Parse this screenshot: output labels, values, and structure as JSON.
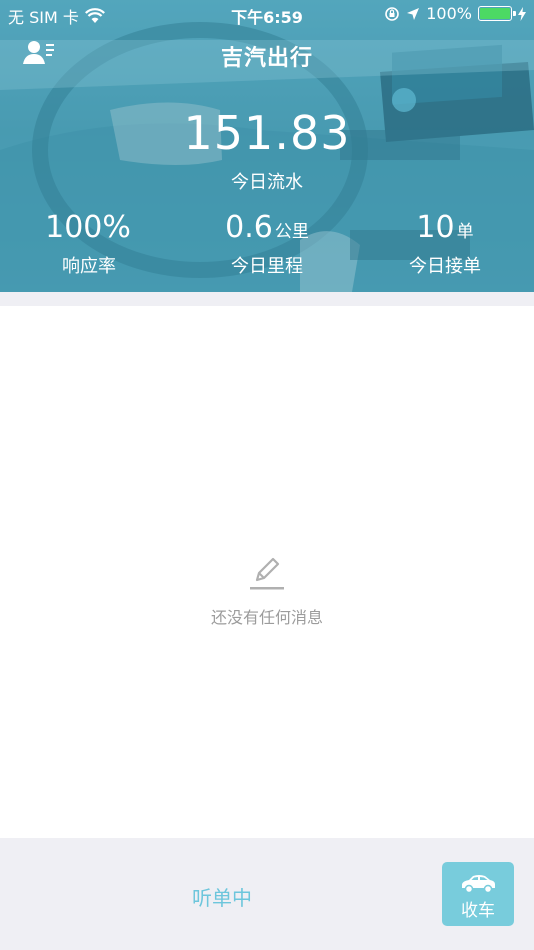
{
  "status_bar": {
    "carrier": "无 SIM 卡",
    "time": "下午6:59",
    "battery": "100%",
    "battery_level": 1.0
  },
  "header": {
    "title": "吉汽出行"
  },
  "revenue": {
    "value": "151.83",
    "label": "今日流水"
  },
  "stats": [
    {
      "value": "100%",
      "unit": "",
      "label": "响应率"
    },
    {
      "value": "0.6",
      "unit": "公里",
      "label": "今日里程"
    },
    {
      "value": "10",
      "unit": "单",
      "label": "今日接单"
    }
  ],
  "empty_state": {
    "icon": "pencil-icon",
    "text": "还没有任何消息"
  },
  "bottom_bar": {
    "status": "听单中",
    "collect_label": "收车",
    "collect_icon": "car-icon"
  },
  "colors": {
    "accent": "#6dc6dc",
    "button": "#78ccdc",
    "hero": "#4e98ad",
    "battery_green": "#4cd964",
    "muted_text": "#9c9c9c",
    "page_gray": "#efeff4"
  }
}
